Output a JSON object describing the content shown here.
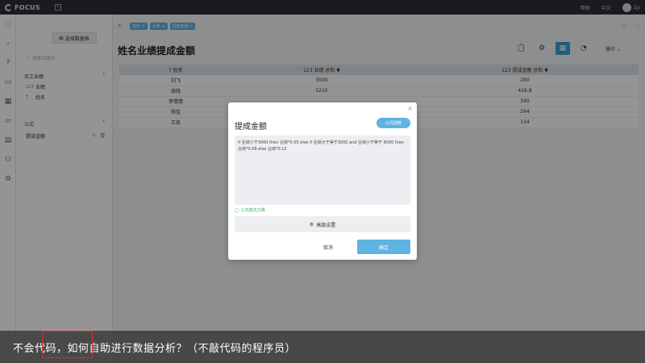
{
  "app": {
    "logo_text": "FOCUS",
    "add_tab_glyph": "+",
    "help_label": "帮助",
    "lang_label": "中文",
    "user_label": "zjy"
  },
  "rail": {
    "icons": [
      "search-icon",
      "question-icon",
      "inbox-icon",
      "grid-icon",
      "folder-icon",
      "file-icon",
      "user-icon",
      "gear-icon"
    ]
  },
  "panel": {
    "select_button": "选择数据表",
    "search_placeholder": "搜索关键词",
    "table_group": "员工业绩",
    "fields": [
      {
        "type_glyph": "123",
        "label": "业绩"
      },
      {
        "type_glyph": "T",
        "label": "姓名"
      }
    ],
    "formula_group": "公式",
    "formula_item": "提成金额"
  },
  "main": {
    "search_tokens": [
      "姓名",
      "业绩",
      "提成金额"
    ],
    "title": "姓名业绩提成金额",
    "ops_menu": "操作",
    "table": {
      "headers": [
        "姓名",
        "业绩 总和",
        "提成金额 总和"
      ],
      "rows": [
        [
          "刘飞",
          "3500",
          "280"
        ],
        [
          "周晓",
          "5210",
          "416.8"
        ],
        [
          "李倩倩",
          "",
          "340"
        ],
        [
          "杨佳",
          "",
          "264"
        ],
        [
          "王凯",
          "",
          "114"
        ]
      ]
    }
  },
  "dialog": {
    "title": "提成金额",
    "badge": "公式函数",
    "formula": "if 业绩小于3000 then 业绩*0.05 else if 业绩大于等于3000 and 业绩小于等于 8000 then 业绩*0.08 else  业绩*0.12",
    "hint": "公式格式正确",
    "advanced": "高级设置",
    "cancel": "取消",
    "ok": "确定"
  },
  "caption": {
    "text": "不会代码，如何自助进行数据分析？（不敲代码的程序员）"
  }
}
